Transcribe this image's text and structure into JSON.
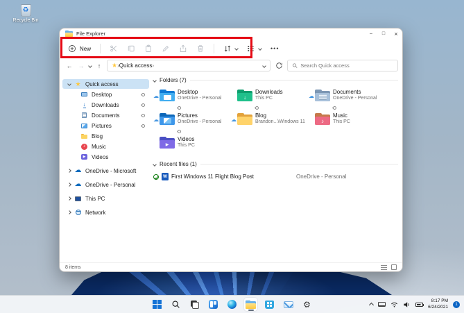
{
  "desktop": {
    "recycle_bin": {
      "label": "Recycle Bin"
    }
  },
  "window": {
    "title": "File Explorer",
    "controls": {
      "minimize": "–",
      "maximize": "□",
      "close": "×"
    },
    "toolbar": {
      "new_label": "New",
      "more_label": "•••",
      "items": [
        "new",
        "cut",
        "copy",
        "paste",
        "rename",
        "share",
        "delete",
        "sort",
        "view",
        "see-more"
      ]
    },
    "address": {
      "separator": "›",
      "breadcrumb": "Quick access",
      "search_placeholder": "Search Quick access"
    },
    "sidebar": {
      "items": [
        {
          "label": "Quick access",
          "icon": "star",
          "selected": true
        },
        {
          "label": "Desktop",
          "icon": "desktop",
          "pinned": true
        },
        {
          "label": "Downloads",
          "icon": "downloads",
          "pinned": true
        },
        {
          "label": "Documents",
          "icon": "documents",
          "pinned": true
        },
        {
          "label": "Pictures",
          "icon": "pictures",
          "pinned": true
        },
        {
          "label": "Blog",
          "icon": "folder"
        },
        {
          "label": "Music",
          "icon": "music"
        },
        {
          "label": "Videos",
          "icon": "videos"
        },
        {
          "label": "OneDrive - Microsoft",
          "icon": "onedrive-cloud"
        },
        {
          "label": "OneDrive - Personal",
          "icon": "onedrive-cloud"
        },
        {
          "label": "This PC",
          "icon": "this-pc"
        },
        {
          "label": "Network",
          "icon": "network"
        }
      ]
    },
    "sections": {
      "folders": {
        "title": "Folders (7)",
        "tiles": [
          {
            "name": "Desktop",
            "location": "OneDrive - Personal",
            "cloud": true,
            "pinned": true,
            "kind": "desktop"
          },
          {
            "name": "Downloads",
            "location": "This PC",
            "cloud": false,
            "pinned": true,
            "kind": "downloads"
          },
          {
            "name": "Documents",
            "location": "OneDrive - Personal",
            "cloud": true,
            "pinned": true,
            "kind": "documents"
          },
          {
            "name": "Pictures",
            "location": "OneDrive - Personal",
            "cloud": true,
            "pinned": true,
            "kind": "pictures"
          },
          {
            "name": "Blog",
            "location": "Brandon...\\Windows 11",
            "cloud": true,
            "pinned": false,
            "kind": "generic"
          },
          {
            "name": "Music",
            "location": "This PC",
            "cloud": false,
            "pinned": false,
            "kind": "music"
          },
          {
            "name": "Videos",
            "location": "This PC",
            "cloud": false,
            "pinned": false,
            "kind": "videos"
          }
        ]
      },
      "recent": {
        "title": "Recent files (1)",
        "files": [
          {
            "name": "First Windows 11 Flight Blog Post",
            "location": "OneDrive - Personal",
            "sync_status": "synced",
            "file_type": "word-document"
          }
        ]
      }
    },
    "status_bar": {
      "items_count": "8 items"
    }
  },
  "annotation": {
    "type": "highlight-rectangle",
    "color": "#e50914",
    "target": "toolbar"
  },
  "taskbar": {
    "buttons": [
      {
        "name": "start"
      },
      {
        "name": "search"
      },
      {
        "name": "task-view"
      },
      {
        "name": "widgets"
      },
      {
        "name": "edge"
      },
      {
        "name": "file-explorer",
        "active": true
      },
      {
        "name": "store"
      },
      {
        "name": "mail"
      },
      {
        "name": "settings"
      }
    ],
    "tray": {
      "time": "8:17 PM",
      "date": "6/24/2021",
      "notification_badge": "1"
    }
  },
  "colors": {
    "accent": "#0b64c4",
    "annotation_red": "#e50914",
    "selection_blue": "#cbe2f5"
  }
}
